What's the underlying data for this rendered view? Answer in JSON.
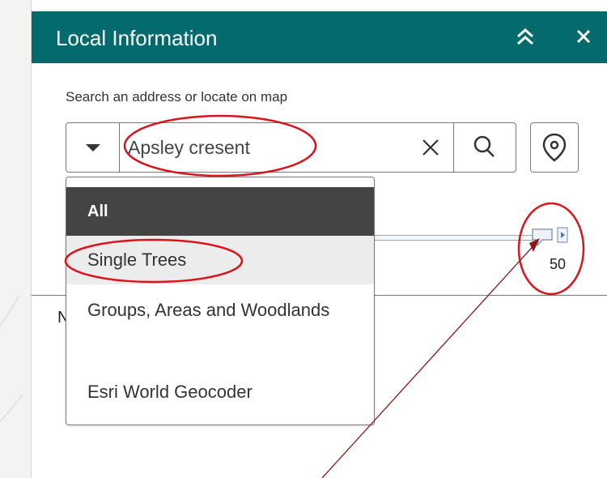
{
  "panel": {
    "title": "Local Information",
    "header_color": "#036a6e",
    "collapse_icon": "chevrons-up-icon",
    "close_icon": "close-icon"
  },
  "search": {
    "prompt": "Search an address or locate on map",
    "value": "Apsley cresent",
    "toggle_icon": "caret-down-icon",
    "clear_icon": "close-icon",
    "search_icon": "search-icon",
    "locate_icon": "location-pin-icon"
  },
  "dropdown": {
    "selected": "All",
    "options": [
      "All",
      "Single Trees",
      "Groups, Areas and Woodlands",
      "Esri World Geocoder"
    ]
  },
  "slider": {
    "value": "50"
  },
  "behind_text": "N",
  "annotations": {
    "color": "#d9141b",
    "arrow_color": "#8b1a1a"
  }
}
